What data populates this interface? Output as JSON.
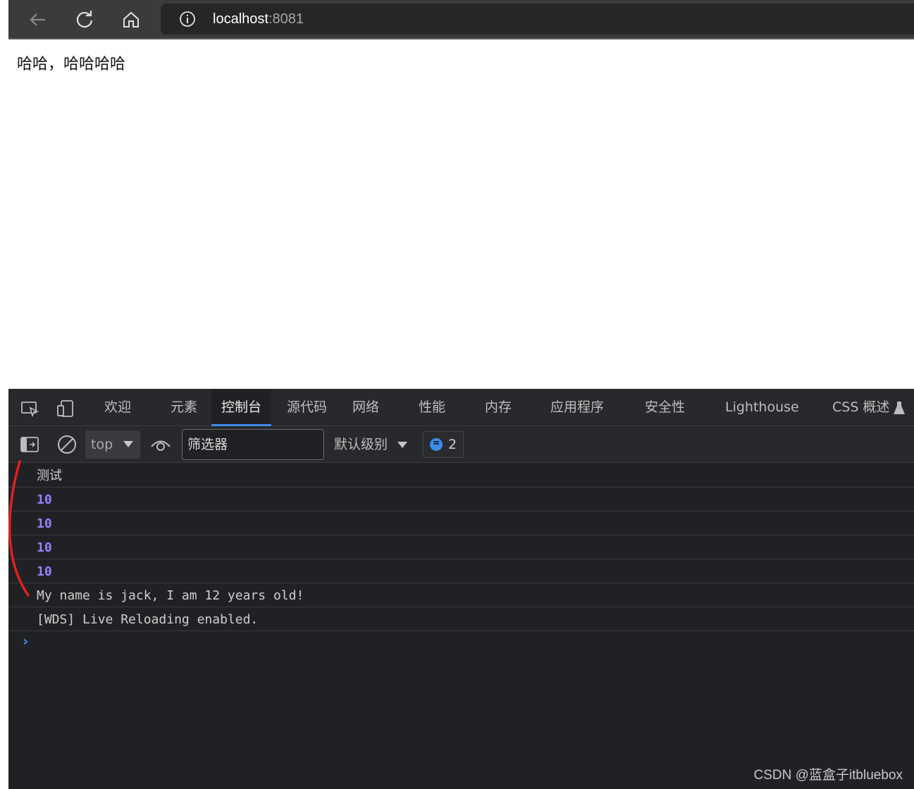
{
  "browser": {
    "url_host": "localhost",
    "url_port": ":8081",
    "icons": [
      "back-arrow-icon",
      "reload-icon",
      "home-icon",
      "info-icon"
    ]
  },
  "page": {
    "text": "哈哈，哈哈哈哈"
  },
  "devtools": {
    "tabs": [
      {
        "label": "欢迎",
        "active": false
      },
      {
        "label": "元素",
        "active": false
      },
      {
        "label": "控制台",
        "active": true
      },
      {
        "label": "源代码",
        "active": false
      },
      {
        "label": "网络",
        "active": false
      },
      {
        "label": "性能",
        "active": false
      },
      {
        "label": "内存",
        "active": false
      },
      {
        "label": "应用程序",
        "active": false
      },
      {
        "label": "安全性",
        "active": false
      },
      {
        "label": "Lighthouse",
        "active": false
      },
      {
        "label": "CSS 概述",
        "active": false
      }
    ],
    "toolbar": {
      "context": "top",
      "filter_placeholder": "筛选器",
      "level": "默认级别",
      "message_count": "2"
    },
    "console_lines": [
      {
        "text": "测试",
        "kind": "cjk"
      },
      {
        "text": "10",
        "kind": "num"
      },
      {
        "text": "10",
        "kind": "num"
      },
      {
        "text": "10",
        "kind": "num"
      },
      {
        "text": "10",
        "kind": "num"
      },
      {
        "text": "My name is jack, I am 12 years old!",
        "kind": "log"
      },
      {
        "text": "[WDS] Live Reloading enabled.",
        "kind": "log"
      }
    ],
    "prompt": "›",
    "accent_color": "#3d8be9",
    "number_color": "#9980ff"
  },
  "watermark": "CSDN @蓝盒子itbluebox"
}
